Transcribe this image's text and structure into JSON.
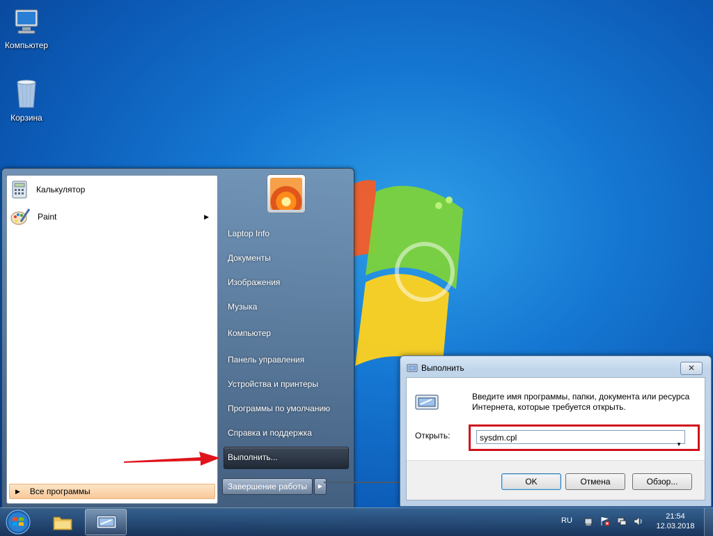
{
  "desktop": {
    "icons": [
      {
        "label": "Компьютер",
        "icon": "computer-icon"
      },
      {
        "label": "Корзина",
        "icon": "recycle-bin-icon"
      }
    ]
  },
  "start_menu": {
    "pinned": [
      {
        "label": "Калькулятор",
        "icon": "calculator-icon"
      },
      {
        "label": "Paint",
        "icon": "paint-icon",
        "has_submenu": true
      }
    ],
    "all_programs": "Все программы",
    "right_links": [
      "Laptop Info",
      "Документы",
      "Изображения",
      "Музыка",
      "Компьютер",
      "Панель управления",
      "Устройства и принтеры",
      "Программы по умолчанию",
      "Справка и поддержка",
      "Выполнить..."
    ],
    "shutdown": "Завершение работы"
  },
  "run_dialog": {
    "title": "Выполнить",
    "description": "Введите имя программы, папки, документа или ресурса Интернета, которые требуется открыть.",
    "open_label": "Открыть:",
    "open_value": "sysdm.cpl",
    "buttons": {
      "ok": "OK",
      "cancel": "Отмена",
      "browse": "Обзор..."
    }
  },
  "taskbar": {
    "language": "RU",
    "time": "21:54",
    "date": "12.03.2018"
  },
  "colors": {
    "highlight_box": "#d0121b",
    "annotation_arrow": "#e0141c"
  }
}
